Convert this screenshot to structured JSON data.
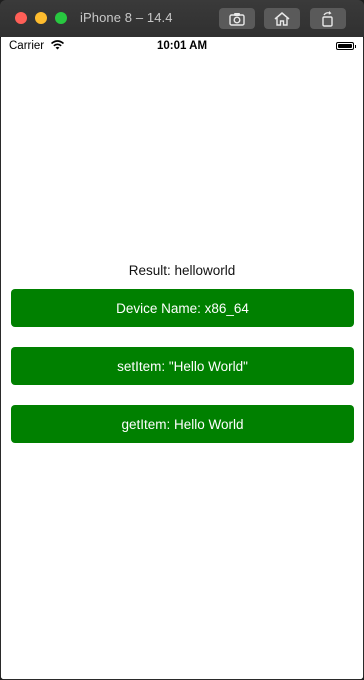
{
  "window": {
    "title": "iPhone 8 – 14.4",
    "toolbar": {
      "screenshot_icon": "camera-icon",
      "home_icon": "home-icon",
      "rotate_icon": "rotate-icon"
    }
  },
  "statusbar": {
    "carrier": "Carrier",
    "wifi_icon": "wifi-icon",
    "time": "10:01 AM",
    "battery_icon": "battery-icon"
  },
  "app": {
    "result": "Result: helloworld",
    "buttons": {
      "device_name": "Device Name: x86_64",
      "set_item": "setItem: \"Hello World\"",
      "get_item": "getItem: Hello World"
    },
    "colors": {
      "button_bg": "#008000",
      "button_text": "#ffffff"
    }
  }
}
